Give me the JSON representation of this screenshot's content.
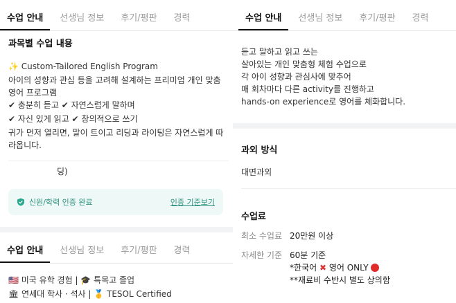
{
  "tabs": [
    "수업 안내",
    "선생님 정보",
    "후기/평판",
    "경력"
  ],
  "left_top": {
    "section_title": "과목별 수업 내용",
    "lines": [
      "✨ Custom-Tailored English Program",
      "아이의 성향과 관심 등을 고려해 설계하는 프리미엄 개인 맞춤 영어 프로그램",
      "✔ 충분히 듣고 ✔ 자연스럽게 말하며",
      "✔ 자신 있게 읽고 ✔ 창의적으로 쓰기",
      "귀가 먼저 열리면, 말이 트이고 리딩과 라이팅은 자연스럽게 따라옵니다."
    ],
    "peek_text": "딩)",
    "verify_label": "신원/학력 인증 완료",
    "verify_link": "인증 기준보기"
  },
  "left_bottom": {
    "lines": [
      "🇺🇸 미국 유학 경험 | 🎓 특목고 졸업",
      "🏛 연세대 학사 · 석사 | 🥇 TESOL Certified"
    ]
  },
  "right": {
    "intro_lines": [
      "듣고 말하고 읽고 쓰는",
      "살아있는 개인 맞춤형 체험 수업으로",
      "각 아이 성향과 관심사에 맞추어",
      "매 회차마다 다른 activity를 진행하고",
      "hands-on experience로 영어를 체화합니다."
    ],
    "method_title": "과외 방식",
    "method_value": "대면과외",
    "fee_title": "수업료",
    "min_fee_key": "최소 수업료",
    "min_fee_value": "20만원 이상",
    "detail_key": "자세한 기준",
    "detail_line1": "60분 기준",
    "detail_line2_a": "*한국어",
    "detail_line2_b": "영어 ONLY",
    "detail_line3": "**재료비 수반시 별도 상의함"
  }
}
